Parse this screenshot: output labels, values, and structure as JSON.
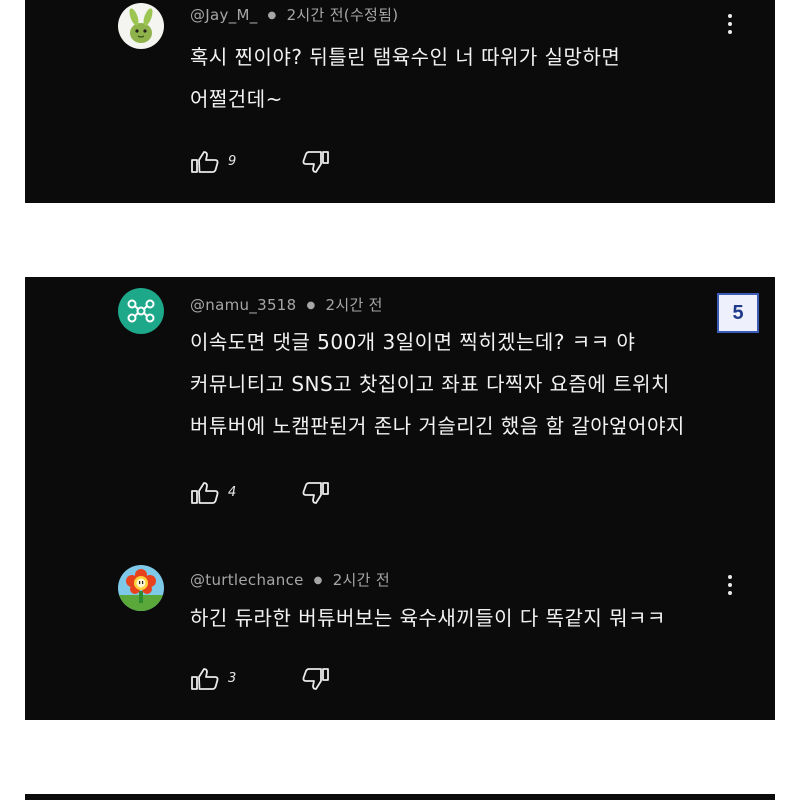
{
  "comments": [
    {
      "handle": "@Jay_M_",
      "time": "2시간 전(수정됨)",
      "lines": [
        "혹시 찐이야? 뒤틀린 탬육수인 너 따위가 실망하면",
        "어쩔건데~"
      ],
      "likes": "9",
      "avatar_icon": "rabbit-avatar-icon"
    },
    {
      "handle": "@namu_3518",
      "time": "2시간 전",
      "lines": [
        "이속도면 댓글 500개 3일이면 찍히겠는데? ㅋㅋ 야",
        "커뮤니티고 SNS고 찻집이고 좌표 다찍자 요즘에 트위치",
        "버튜버에 노캠판된거 존나 거슬리긴 했음 함 갈아엎어야지"
      ],
      "likes": "4",
      "avatar_icon": "network-avatar-icon"
    },
    {
      "handle": "@turtlechance",
      "time": "2시간 전",
      "lines": [
        "하긴 듀라한 버튜버보는 육수새끼들이 다 똑같지 뭐ㅋㅋ"
      ],
      "likes": "3",
      "avatar_icon": "fire-flower-avatar-icon"
    }
  ],
  "badge": "5",
  "colors": {
    "panel_bg": "#0b0b0b",
    "meta_text": "#a6a6a6",
    "body_text": "#f2f2f2",
    "badge_border": "#3b5bb8"
  }
}
